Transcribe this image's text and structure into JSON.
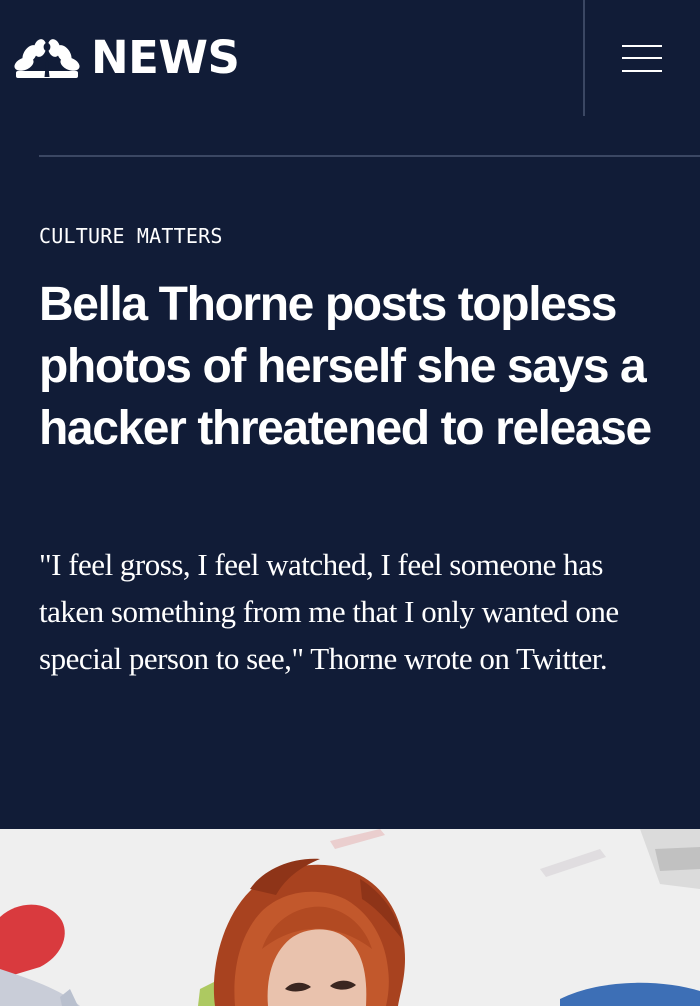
{
  "header": {
    "logo_text": "NEWS",
    "logo_icon": "nbc-peacock-icon",
    "menu_icon": "hamburger-menu-icon"
  },
  "article": {
    "category": "CULTURE MATTERS",
    "headline": "Bella Thorne posts topless photos of herself she says a hacker threatened to release",
    "dek": "\"I feel gross, I feel watched, I feel someone has taken something from me that I only wanted one special person to see,\" Thorne wrote on Twitter."
  },
  "colors": {
    "background": "#111c37",
    "text": "#ffffff",
    "divider": "#3b4763"
  }
}
